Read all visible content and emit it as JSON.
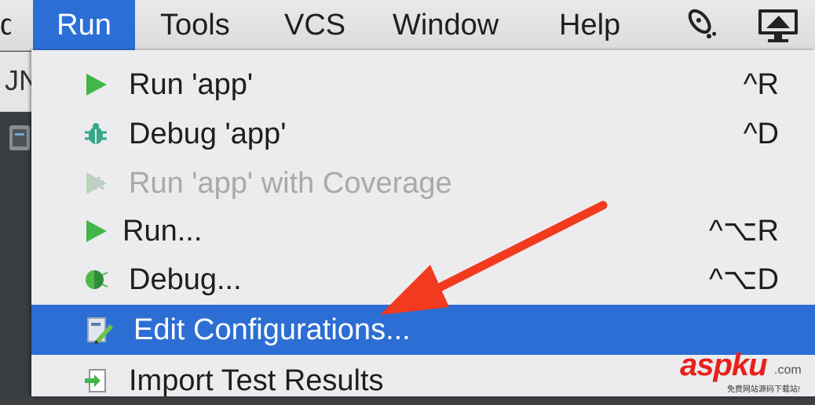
{
  "menubar": {
    "items": [
      {
        "label": "d"
      },
      {
        "label": "Run"
      },
      {
        "label": "Tools"
      },
      {
        "label": "VCS"
      },
      {
        "label": "Window"
      },
      {
        "label": "Help"
      }
    ],
    "tray_icons": [
      "rocket-icon",
      "display-icon"
    ]
  },
  "side": {
    "tab_label": "JN"
  },
  "run_menu": {
    "items": [
      {
        "label": "Run 'app'",
        "shortcut": "^R",
        "icon": "run-play-icon",
        "state": "enabled"
      },
      {
        "label": "Debug 'app'",
        "shortcut": "^D",
        "icon": "debug-bug-icon",
        "state": "enabled"
      },
      {
        "label": "Run 'app' with Coverage",
        "shortcut": "",
        "icon": "coverage-icon",
        "state": "disabled"
      },
      {
        "label": "Run...",
        "shortcut": "^⌥R",
        "icon": "run-play-icon",
        "state": "enabled"
      },
      {
        "label": "Debug...",
        "shortcut": "^⌥D",
        "icon": "debug-bug-icon",
        "state": "enabled"
      },
      {
        "label": "Edit Configurations...",
        "shortcut": "",
        "icon": "edit-configurations-icon",
        "state": "selected"
      },
      {
        "label": "Import Test Results",
        "shortcut": "",
        "icon": "import-icon",
        "state": "enabled"
      }
    ]
  },
  "watermark": {
    "brand": "aspku",
    "domain": ".com",
    "tagline": "免费网站源码下载站!"
  },
  "colors": {
    "selection": "#2c6ed3",
    "annotation_arrow": "#f23a1f",
    "run_green": "#43b649"
  }
}
